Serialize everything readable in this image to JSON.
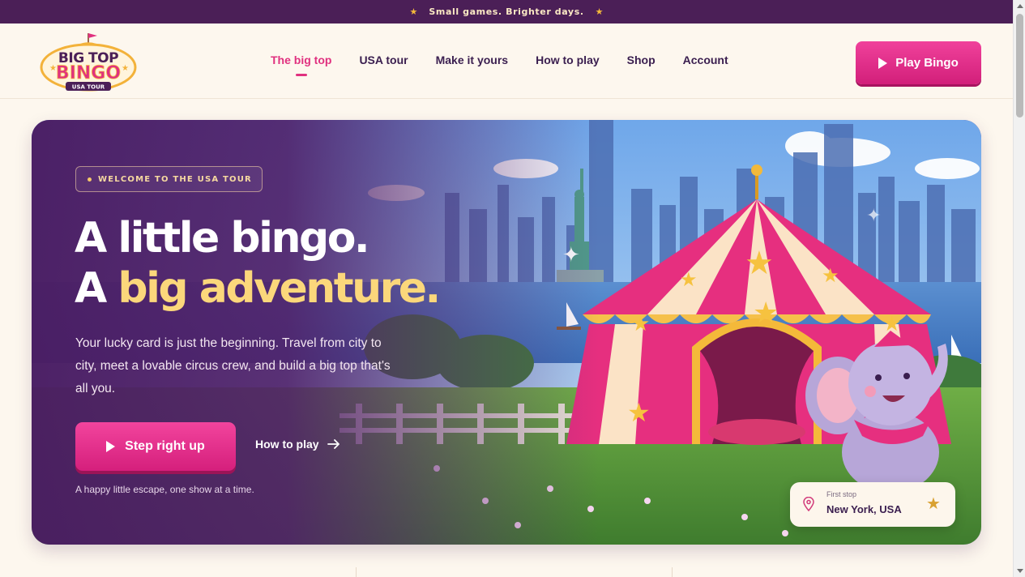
{
  "announcement": {
    "text": "Small games. Brighter days.",
    "star_icon": "star-icon"
  },
  "logo": {
    "line1": "BIG TOP",
    "line2": "BINGO",
    "line3": "USA TOUR"
  },
  "nav": {
    "items": [
      {
        "label": "The big top",
        "active": true
      },
      {
        "label": "USA tour",
        "active": false
      },
      {
        "label": "Make it yours",
        "active": false
      },
      {
        "label": "How to play",
        "active": false
      },
      {
        "label": "Shop",
        "active": false
      },
      {
        "label": "Account",
        "active": false
      }
    ],
    "cta_label": "Play Bingo"
  },
  "hero": {
    "badge": "WELCOME TO THE USA TOUR",
    "headline_line1": "A little bingo.",
    "headline_line2_prefix": "A",
    "headline_line2_highlight": "big adventure.",
    "body": "Your lucky card is just the beginning. Travel from city to city, meet a lovable circus crew, and build a big top that's all you.",
    "primary_cta": "Step right up",
    "secondary_cta": "How to play",
    "footnote": "A happy little escape, one show at a time.",
    "stop_card": {
      "label": "First stop",
      "city": "New York, USA"
    }
  },
  "colors": {
    "brand_pink": "#e0307f",
    "brand_purple": "#4b1f57",
    "accent_gold": "#fbd77b",
    "background": "#fdf7ee"
  }
}
